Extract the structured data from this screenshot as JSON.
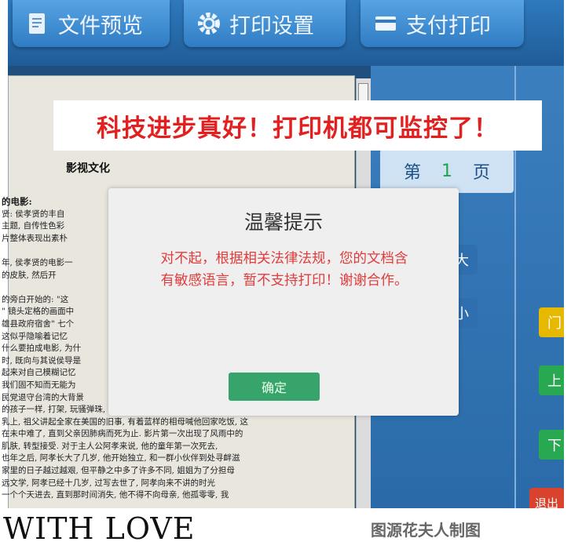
{
  "toolbar": {
    "preview_label": "文件预览",
    "print_settings_label": "打印设置",
    "pay_print_label": "支付打印"
  },
  "banner": {
    "text": "科技进步真好！打印机都可监控了！"
  },
  "document": {
    "heading": "影视文化",
    "lines": [
      "的电影:",
      "贤: 侯孝贤的丰自",
      "主题, 自传性色彩",
      "片整体表现出素朴",
      "",
      "年, 侯孝贤的电影一",
      "的皮肤, 然后开",
      "",
      "的旁白开始的: \"这",
      "\" 镜头定格的画面中",
      "雄县政府宿舍\" 七个",
      "这似乎隐喻着记忆",
      "什么要拍成电影, 为什",
      "时, 既向与其说侯导是",
      "起来对自己模糊记忆",
      "我们固不知而无能为",
      "民党退守台湾的大背景",
      "的孩子一样, 打架, 玩骚弹珠, 大树, 鸟声, 父亲一如既往的沉默,",
      "乳上, 祖父讲起全家在美国的旧事, 有着蓝样的相母喊他回家吃饭, 这",
      "在未中难了, 直到父亲因肺病而死为止. 影片第一次出现了风雨中的",
      "肌肤, 转型接受. 对于主人公阿孝来说, 他的童年第一次死去,",
      "也年之后, 阿孝长大了几岁, 他开始独立, 和一群小伙伴到处寻衅滋",
      "家里的日子越过越艰, 但平静之中多了许多不同, 姐姐为了分担母",
      "远文学, 阿孝已经十几岁, 过写去世了, 阿孝向来不讲的时光",
      "一个个天进去, 直到那时间消失, 他不得不向母亲, 他孤零零, 我"
    ]
  },
  "modal": {
    "title": "温馨提示",
    "message_line1": "对不起，根据相关法律法规，您的文档含",
    "message_line2": "有敏感语言，暂不支持打印！谢谢合作。",
    "ok_label": "确定"
  },
  "right_panel": {
    "page_prefix": "第",
    "page_number": "1",
    "page_suffix": "页",
    "side_buttons": [
      "大",
      "小",
      "门",
      "上",
      "下",
      "退出"
    ]
  },
  "footer": {
    "left_text": "WITH LOVE",
    "right_text": "图源花夫人制图"
  },
  "colors": {
    "accent_blue": "#2e79bd",
    "alert_red": "#e23c3c",
    "ok_green": "#36a46b",
    "banner_red": "#e22020"
  }
}
